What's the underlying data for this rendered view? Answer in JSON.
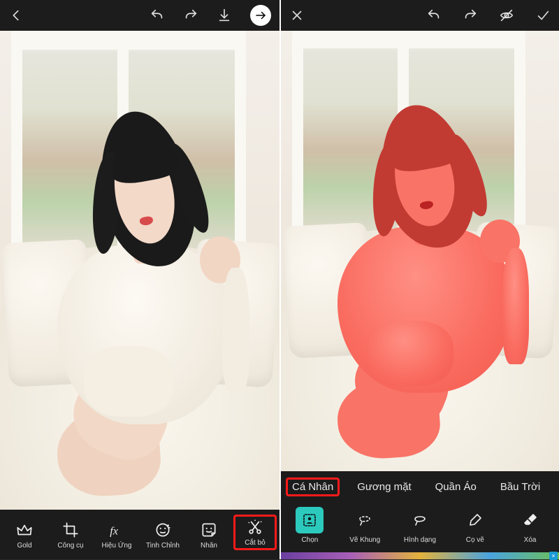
{
  "left": {
    "topbar": {
      "back_icon": "chevron-left",
      "undo_icon": "undo",
      "redo_icon": "redo",
      "save_icon": "download",
      "next_icon": "arrow-right"
    },
    "tools": [
      {
        "id": "gold",
        "label": "Gold",
        "icon": "crown"
      },
      {
        "id": "congcu",
        "label": "Công cụ",
        "icon": "crop"
      },
      {
        "id": "hieuung",
        "label": "Hiệu Ứng",
        "icon": "fx"
      },
      {
        "id": "tinhchinh",
        "label": "Tinh Chỉnh",
        "icon": "face-adjust"
      },
      {
        "id": "nhan",
        "label": "Nhãn",
        "icon": "sticker"
      },
      {
        "id": "catbo",
        "label": "Cắt bỏ",
        "icon": "cutout",
        "highlight": true
      }
    ]
  },
  "right": {
    "topbar": {
      "close_icon": "close",
      "undo_icon": "undo",
      "redo_icon": "redo",
      "eraser_icon": "eraser-strike",
      "confirm_icon": "check"
    },
    "chips": [
      {
        "id": "canhan",
        "label": "Cá Nhân",
        "selected": true
      },
      {
        "id": "guongmat",
        "label": "Gương mặt",
        "selected": false
      },
      {
        "id": "quanao",
        "label": "Quần Áo",
        "selected": false
      },
      {
        "id": "bautroi",
        "label": "Bầu Trời",
        "selected": false
      }
    ],
    "tools": [
      {
        "id": "chon",
        "label": "Chọn",
        "icon": "select-person",
        "selected": true
      },
      {
        "id": "vekhung",
        "label": "Vẽ Khung",
        "icon": "lasso-dash"
      },
      {
        "id": "hinhdang",
        "label": "Hình dạng",
        "icon": "lasso-solid"
      },
      {
        "id": "cove",
        "label": "Cọ vẽ",
        "icon": "brush"
      },
      {
        "id": "xoa",
        "label": "Xóa",
        "icon": "eraser"
      }
    ],
    "ad_close": "×"
  }
}
